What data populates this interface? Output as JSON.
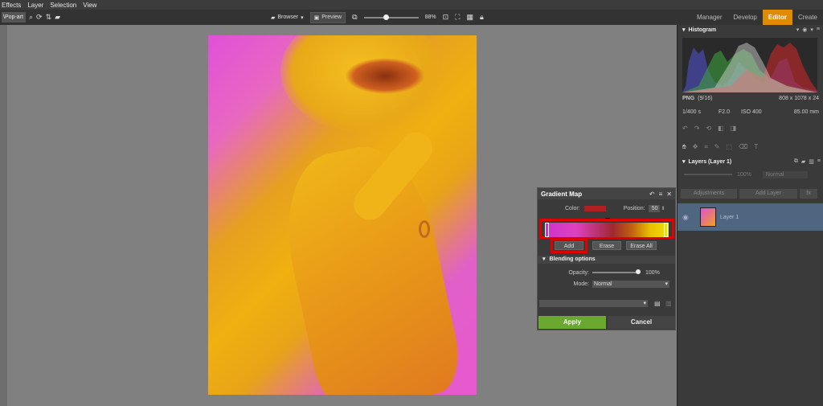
{
  "menu": [
    "Effects",
    "Layer",
    "Selection",
    "View"
  ],
  "toolbar": {
    "path": "\\Pop-art",
    "browser_label": "Browser",
    "preview_label": "Preview",
    "zoom": "88%"
  },
  "modes": [
    "Manager",
    "Develop",
    "Editor",
    "Create"
  ],
  "histogram": {
    "title": "Histogram",
    "format": "PNG",
    "index": "(9/16)",
    "dimensions": "808 x 1078 x 24",
    "shutter": "1/400 s",
    "aperture": "F2.0",
    "iso": "ISO 400",
    "focal": "85.00 mm"
  },
  "layers": {
    "title": "Layers (Layer 1)",
    "opacity": "100%",
    "blend": "Normal",
    "adjustments_label": "Adjustments",
    "add_layer_label": "Add Layer",
    "fx_label": "fx",
    "layer_name": "Layer 1"
  },
  "gradient_map": {
    "title": "Gradient Map",
    "color_label": "Color:",
    "color": "#b02020",
    "position_label": "Position:",
    "position": "50",
    "add_label": "Add",
    "erase_label": "Erase",
    "erase_all_label": "Erase All",
    "blending_label": "Blending options",
    "opacity_label": "Opacity:",
    "opacity_value": "100%",
    "mode_label": "Mode:",
    "mode_value": "Normal",
    "apply_label": "Apply",
    "cancel_label": "Cancel"
  }
}
